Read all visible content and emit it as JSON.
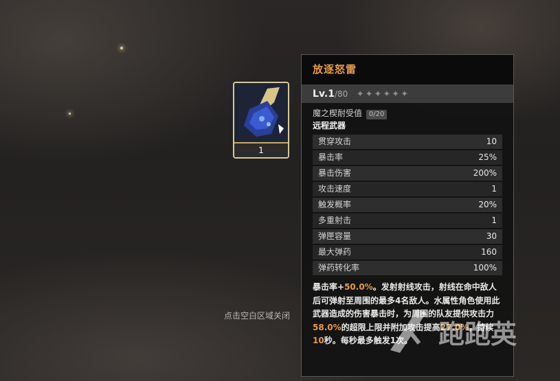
{
  "item": {
    "count": "1",
    "icon": "blue-launcher-weapon"
  },
  "panel": {
    "title": "放逐怒雷",
    "level": "Lv.1",
    "level_max": "/80",
    "stars": "✦✦✦✦✦✦",
    "durability_label": "魔之楔耐受值",
    "durability_value": "0/20",
    "weapon_type": "远程武器",
    "stats": [
      {
        "name": "贯穿攻击",
        "value": "10"
      },
      {
        "name": "暴击率",
        "value": "25%"
      },
      {
        "name": "暴击伤害",
        "value": "200%"
      },
      {
        "name": "攻击速度",
        "value": "1"
      },
      {
        "name": "触发概率",
        "value": "20%"
      },
      {
        "name": "多重射击",
        "value": "1"
      },
      {
        "name": "弹匣容量",
        "value": "30"
      },
      {
        "name": "最大弹药",
        "value": "160"
      },
      {
        "name": "弹药转化率",
        "value": "100%"
      }
    ],
    "description": {
      "p1": "暴击率+",
      "h1": "50.0%",
      "p2": "。发射射线攻击，射线在命中敌人后可弹射至周围的最多4名敌人。水属性角色使用此武器造成的伤害暴击时，为周围的队友提供攻击力",
      "h2": "58.0%",
      "p3": "的超限上限并附加攻击提高",
      "h3": "27.0%",
      "p4": "，持续",
      "h4": "10",
      "p5": "秒。每秒最多触发1次。"
    }
  },
  "close_hint": "点击空白区域关闭",
  "watermark_text": "跑跑英",
  "colors": {
    "accent": "#e89a4a",
    "card_border": "#d8c99a"
  }
}
